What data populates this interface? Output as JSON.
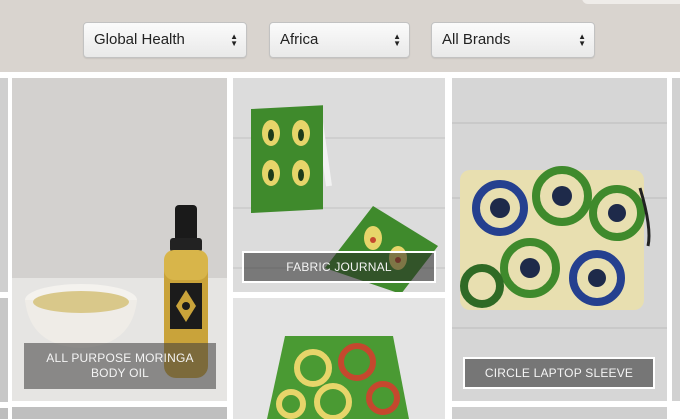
{
  "filters": {
    "category": {
      "selected": "Global Health"
    },
    "region": {
      "selected": "Africa"
    },
    "brand": {
      "selected": "All Brands"
    },
    "arrow_up": "▲",
    "arrow_down": "▼"
  },
  "products": [
    {
      "name": "ALL PURPOSE MORINGA BODY OIL"
    },
    {
      "name": "FABRIC JOURNAL"
    },
    {
      "name": "CIRCLE LAPTOP SLEEVE"
    }
  ],
  "colors": {
    "filter_bar": "#d9d4cf",
    "fabric_green": "#3f8a2c",
    "fabric_yellow": "#e7d56a",
    "fabric_blue": "#25408f"
  }
}
